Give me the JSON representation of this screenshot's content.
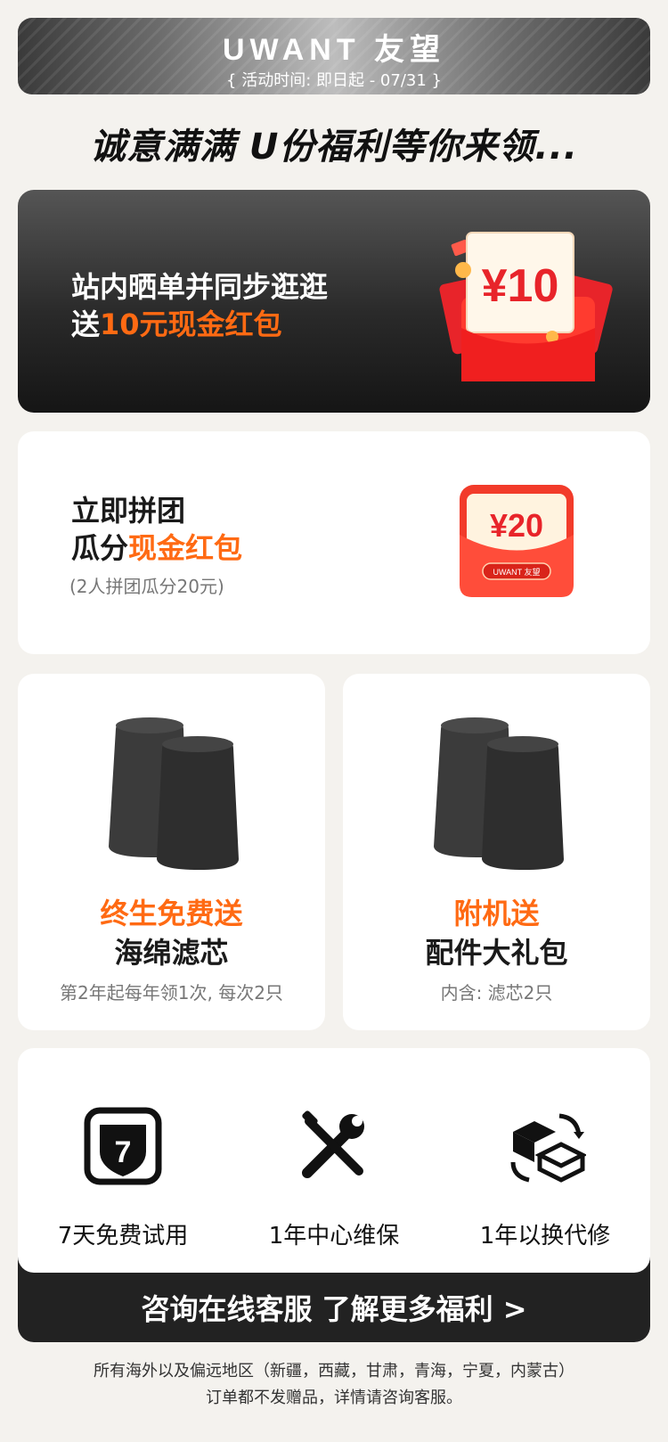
{
  "header": {
    "logo": "UWANT 友望",
    "period": "{ 活动时间: 即日起 - 07/31 }"
  },
  "headline": "诚意满满 U份福利等你来领...",
  "card1": {
    "line1": "站内晒单并同步逛逛",
    "line2_prefix": "送",
    "line2_highlight": "10元现金红包",
    "envelope_amount": "¥10"
  },
  "card2": {
    "line1": "立即拼团",
    "line2_prefix": "瓜分",
    "line2_highlight": "现金红包",
    "note": "(2人拼团瓜分20元)",
    "envelope_amount": "¥20",
    "envelope_brand": "UWANT 友望"
  },
  "card3": {
    "title_highlight": "终生免费送",
    "title": "海绵滤芯",
    "note": "第2年起每年领1次, 每次2只"
  },
  "card4": {
    "title_highlight": "附机送",
    "title": "配件大礼包",
    "note": "内含: 滤芯2只"
  },
  "services": [
    {
      "label": "7天免费试用",
      "icon": "shield-7-icon",
      "badge": "7"
    },
    {
      "label": "1年中心维保",
      "icon": "repair-tools-icon"
    },
    {
      "label": "1年以换代修",
      "icon": "exchange-box-icon"
    }
  ],
  "cta": {
    "label": "咨询在线客服 了解更多福利  >"
  },
  "footer": {
    "line1": "所有海外以及偏远地区（新疆，西藏，甘肃，青海，宁夏，内蒙古）",
    "line2": "订单都不发赠品，详情请咨询客服。"
  },
  "colors": {
    "accent": "#ff6a13",
    "dark": "#222222",
    "envelope_red": "#f23b2a"
  }
}
